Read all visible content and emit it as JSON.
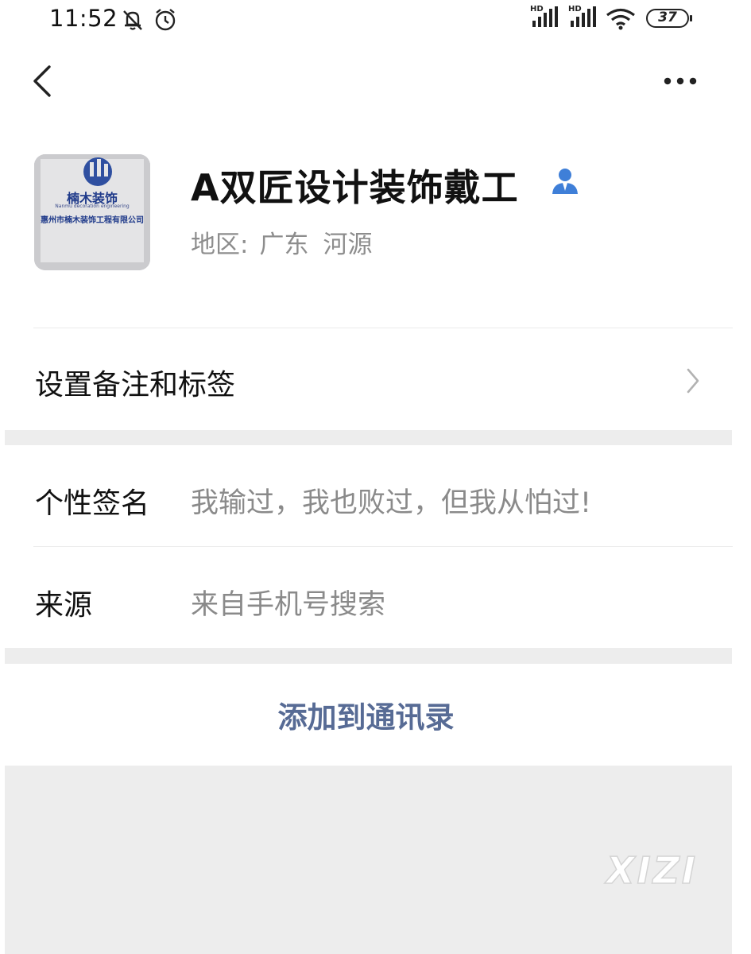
{
  "status_bar": {
    "time": "11:52",
    "network1": "HD",
    "network2": "HD",
    "battery": "37"
  },
  "profile": {
    "name": "A双匠设计装饰戴工",
    "region_label": "地区:",
    "region_province": "广东",
    "region_city": "河源",
    "avatar": {
      "title": "楠木装饰",
      "subtitle": "Nanmu decoration engineering",
      "company": "惠州市楠木装饰工程有限公司"
    }
  },
  "remark_row": {
    "label": "设置备注和标签"
  },
  "signature_row": {
    "label": "个性签名",
    "value": "我输过，我也败过，但我从怕过!"
  },
  "source_row": {
    "label": "来源",
    "value": "来自手机号搜索"
  },
  "actions": {
    "add_contact": "添加到通讯录"
  },
  "watermark": "XIZI",
  "colors": {
    "link_blue": "#576b95",
    "section_gap": "#ededed",
    "secondary_text": "#8d8d8d"
  }
}
